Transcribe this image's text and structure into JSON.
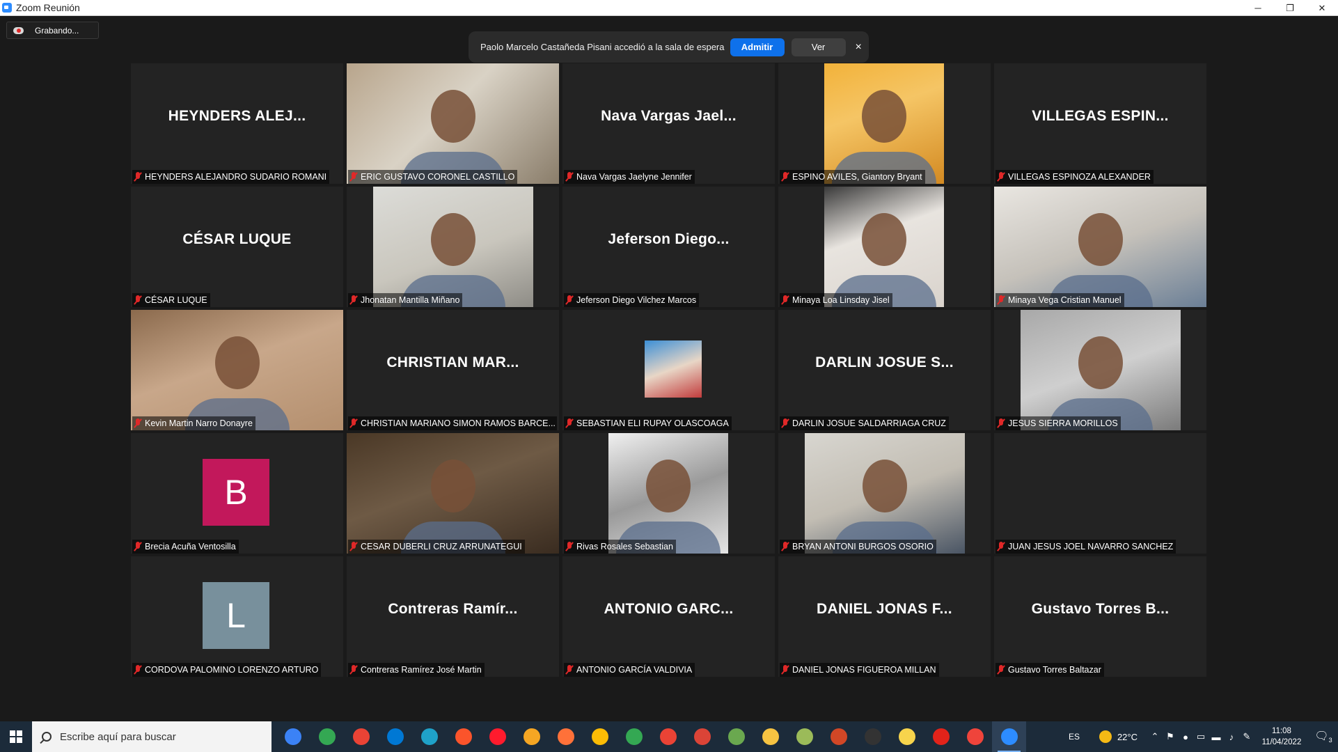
{
  "window": {
    "title": "Zoom Reunión",
    "controls": [
      "─",
      "❐",
      "✕"
    ]
  },
  "recording": {
    "label": "Grabando..."
  },
  "waiting_room": {
    "message": "Paolo Marcelo Castañeda Pisani accedió a la sala de espera",
    "admit_label": "Admitir",
    "view_label": "Ver",
    "close_label": "×"
  },
  "participants": [
    {
      "display": "HEYNDERS ALEJ...",
      "name": "HEYNDERS ALEJANDRO SUDARIO ROMANI",
      "video": false
    },
    {
      "display": "",
      "name": "ERIC GUSTAVO CORONEL CASTILLO",
      "video": true,
      "active": true
    },
    {
      "display": "Nava Vargas Jael...",
      "name": "Nava Vargas Jaelyne Jennifer",
      "video": false
    },
    {
      "display": "",
      "name": "ESPINO AVILES, Giantory Bryant",
      "video": true
    },
    {
      "display": "VILLEGAS ESPIN...",
      "name": "VILLEGAS ESPINOZA ALEXANDER",
      "video": false
    },
    {
      "display": "CÉSAR LUQUE",
      "name": "CÉSAR LUQUE",
      "video": false
    },
    {
      "display": "",
      "name": "Jhonatan Mantilla Miñano",
      "video": true
    },
    {
      "display": "Jeferson Diego...",
      "name": "Jeferson Diego Vilchez Marcos",
      "video": false
    },
    {
      "display": "",
      "name": "Minaya Loa Linsday Jisel",
      "video": true
    },
    {
      "display": "",
      "name": "Minaya Vega Cristian Manuel",
      "video": true
    },
    {
      "display": "",
      "name": "Kevin Martin Narro Donayre",
      "video": true
    },
    {
      "display": "CHRISTIAN MAR...",
      "name": "CHRISTIAN MARIANO SIMON RAMOS BARCE...",
      "video": false
    },
    {
      "display": "",
      "name": "SEBASTIAN ELI RUPAY OLASCOAGA",
      "video": false,
      "photo": true
    },
    {
      "display": "DARLIN JOSUE S...",
      "name": "DARLIN JOSUE SALDARRIAGA CRUZ",
      "video": false
    },
    {
      "display": "",
      "name": "JESUS SIERRA MORILLOS",
      "video": true
    },
    {
      "display": "",
      "name": "Brecia Acuña Ventosilla",
      "video": false,
      "avatar": "B",
      "avatar_color": "#c2185b"
    },
    {
      "display": "",
      "name": "CESAR DUBERLI CRUZ ARRUNATEGUI",
      "video": true
    },
    {
      "display": "",
      "name": "Rivas Rosales Sebastian",
      "video": true
    },
    {
      "display": "",
      "name": "BRYAN ANTONI BURGOS OSORIO",
      "video": true
    },
    {
      "display": "",
      "name": "JUAN JESUS JOEL NAVARRO SANCHEZ",
      "video": false
    },
    {
      "display": "",
      "name": "CORDOVA PALOMINO LORENZO ARTURO",
      "video": false,
      "avatar": "L",
      "avatar_color": "#78909c"
    },
    {
      "display": "Contreras Ramír...",
      "name": "Contreras Ramírez  José Martin",
      "video": false
    },
    {
      "display": "ANTONIO GARC...",
      "name": "ANTONIO GARCÍA VALDIVIA",
      "video": false
    },
    {
      "display": "DANIEL JONAS F...",
      "name": "DANIEL JONAS FIGUEROA MILLAN",
      "video": false
    },
    {
      "display": "Gustavo Torres B...",
      "name": "Gustavo Torres Baltazar",
      "video": false
    }
  ],
  "taskbar": {
    "search_placeholder": "Escribe aquí para buscar",
    "apps": [
      {
        "name": "cortana-icon",
        "color": "#3b82f6"
      },
      {
        "name": "chrome-icon",
        "color": "#34a853"
      },
      {
        "name": "chrome-profile-icon",
        "color": "#ea4335"
      },
      {
        "name": "mail-icon",
        "color": "#0078d4"
      },
      {
        "name": "edge-icon",
        "color": "#1fa2c9"
      },
      {
        "name": "brave-icon",
        "color": "#fb542b"
      },
      {
        "name": "opera-icon",
        "color": "#ff1b2d"
      },
      {
        "name": "tor-icon",
        "color": "#f5a623"
      },
      {
        "name": "firefox-icon",
        "color": "#ff7139"
      },
      {
        "name": "chrome-2-icon",
        "color": "#fbbc05"
      },
      {
        "name": "chrome-3-icon",
        "color": "#34a853"
      },
      {
        "name": "chrome-4-icon",
        "color": "#ea4335"
      },
      {
        "name": "chrome-5-icon",
        "color": "#db4437"
      },
      {
        "name": "photos-icon",
        "color": "#6aa84f"
      },
      {
        "name": "file-explorer-icon",
        "color": "#f6c342"
      },
      {
        "name": "notepad-icon",
        "color": "#9bbb59"
      },
      {
        "name": "powerpoint-icon",
        "color": "#d24726"
      },
      {
        "name": "terminal-icon",
        "color": "#333333"
      },
      {
        "name": "sticky-notes-icon",
        "color": "#f7d44c"
      },
      {
        "name": "acrobat-icon",
        "color": "#e2231a"
      },
      {
        "name": "anydesk-icon",
        "color": "#ef443b"
      },
      {
        "name": "zoom-icon",
        "color": "#2d8cff",
        "active": true
      }
    ],
    "language": "ES",
    "weather": "22°C",
    "time": "11:08",
    "date": "11/04/2022",
    "notifications": "3"
  }
}
